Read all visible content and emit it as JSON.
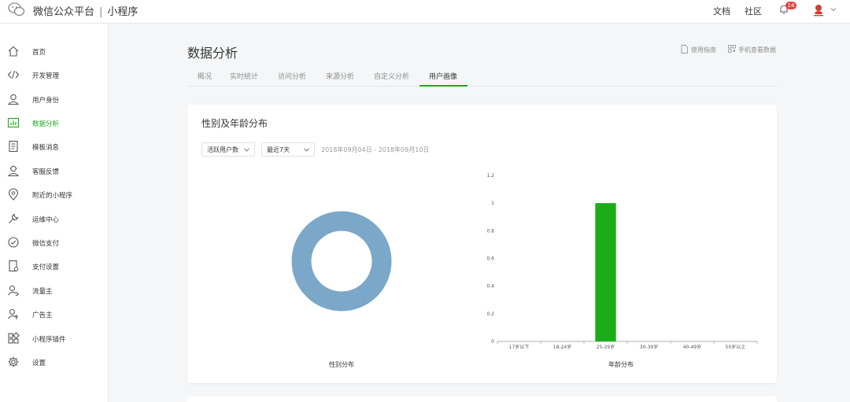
{
  "topbar": {
    "brand": "微信公众平台",
    "separator": "|",
    "product": "小程序",
    "links": {
      "docs": "文档",
      "community": "社区"
    },
    "notification_count": "14"
  },
  "sidebar": {
    "accent": "#1aad19",
    "items": [
      {
        "label": "首页",
        "icon": "home-icon"
      },
      {
        "label": "开发管理",
        "icon": "code-icon"
      },
      {
        "label": "用户身份",
        "icon": "user-icon"
      },
      {
        "label": "数据分析",
        "icon": "chart-icon",
        "active": true
      },
      {
        "label": "模板消息",
        "icon": "document-icon"
      },
      {
        "label": "客服反馈",
        "icon": "support-icon"
      },
      {
        "label": "附近的小程序",
        "icon": "location-icon"
      },
      {
        "label": "运维中心",
        "icon": "wrench-icon"
      },
      {
        "label": "微信支付",
        "icon": "pay-icon"
      },
      {
        "label": "支付设置",
        "icon": "pay-settings-icon"
      },
      {
        "label": "流量主",
        "icon": "traffic-icon"
      },
      {
        "label": "广告主",
        "icon": "advertiser-icon"
      },
      {
        "label": "小程序插件",
        "icon": "plugin-icon"
      },
      {
        "label": "设置",
        "icon": "gear-icon"
      }
    ]
  },
  "main": {
    "title": "数据分析",
    "guide_link": "使用指南",
    "mobile_link": "手机查看数据",
    "tabs": [
      {
        "label": "概况"
      },
      {
        "label": "实时统计"
      },
      {
        "label": "访问分析"
      },
      {
        "label": "来源分析"
      },
      {
        "label": "自定义分析"
      },
      {
        "label": "用户画像",
        "active": true
      }
    ]
  },
  "card": {
    "title": "性别及年龄分布",
    "metric_select": "活跃用户数",
    "period_select": "最近7天",
    "date_range": "2018年09月04日 - 2018年09月10日",
    "gender_caption": "性别分布",
    "age_caption": "年龄分布"
  },
  "chart_data": [
    {
      "type": "pie",
      "title": "",
      "xlabel": "性别分布",
      "series": [
        {
          "values": [
            1
          ],
          "color": "#7ba7c9"
        }
      ],
      "donut": true
    },
    {
      "type": "bar",
      "title": "",
      "xlabel": "年龄分布",
      "ylabel": "",
      "categories": [
        "17岁以下",
        "18-24岁",
        "25-29岁",
        "30-39岁",
        "40-49岁",
        "50岁以上"
      ],
      "values": [
        0,
        0,
        1,
        0,
        0,
        0
      ],
      "yticks": [
        "0",
        "0.2",
        "0.4",
        "0.6",
        "0.8",
        "1",
        "1.2"
      ],
      "ylim": [
        0,
        1.2
      ],
      "bar_color": "#1aad19",
      "grid": false
    }
  ]
}
